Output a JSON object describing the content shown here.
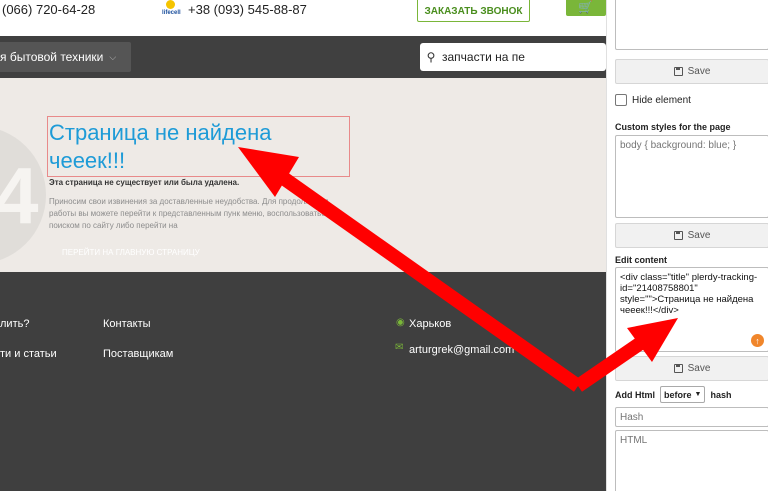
{
  "site": {
    "phone1": "(066) 720-64-28",
    "phone2": "+38 (093) 545-88-87",
    "operator_logo_text": "lifecell",
    "callback_label": "ЗАКАЗАТЬ ЗВОНОК",
    "catalog_label": "я бытовой техники",
    "search_value": "запчасти на пе",
    "hero": {
      "title": "Страница не найдена чееек!!!",
      "subtitle": "Эта страница не существует или была удалена.",
      "description": "Приносим свои извинения за доставленные неудобства. Для продолжения работы вы можете перейти к представленным пунк меню, воспользоваться поиском по сайту либо перейти на",
      "home_link": "ПЕРЕЙТИ НА ГЛАВНУЮ СТРАНИЦУ",
      "decor_number": "4"
    },
    "footer": {
      "col1": [
        "лить?",
        "ти и статьи"
      ],
      "col2": [
        "Контакты",
        "Поставщикам"
      ],
      "city": "Харьков",
      "email": "arturgrek@gmail.com"
    }
  },
  "panel": {
    "save_label": "Save",
    "hide_element_label": "Hide element",
    "custom_styles_label": "Custom styles for the page",
    "custom_styles_placeholder": "body { background: blue; }",
    "edit_content_label": "Edit content",
    "edit_content_value": "<div class=\"title\" plerdy-tracking-id=\"21408758801\" style=\"\">Страница не найдена чееек!!!</div>",
    "add_html_label": "Add Html",
    "position_selected": "before",
    "hash_label": "hash",
    "hash_placeholder": "Hash",
    "html_placeholder": "HTML"
  },
  "colors": {
    "accent_green": "#7ab639",
    "title_blue": "#1e9bd7",
    "arrow_red": "#ff0000",
    "footer_bg": "#3f3f3f"
  }
}
